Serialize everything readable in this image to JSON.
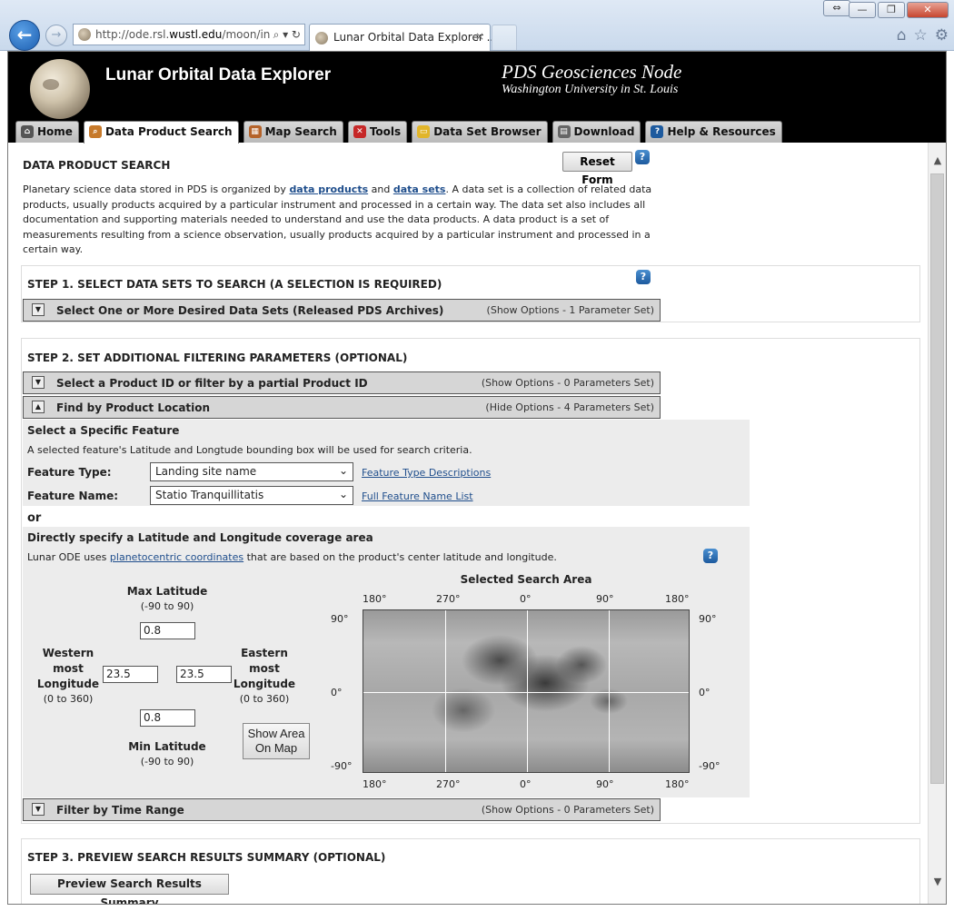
{
  "browser": {
    "url_prefix": "http://ode.rsl.",
    "url_domain": "wustl.edu",
    "url_suffix": "/moon/in",
    "tab_title": "Lunar Orbital Data Explorer ...",
    "tab_close": "×",
    "back": "←",
    "forward": "→",
    "addr_icons": "⌕ ▾ ↻",
    "win_buttons": [
      "—",
      "❐",
      "✕"
    ],
    "resize": "⇔",
    "tools": [
      "⌂",
      "☆",
      "⚙"
    ]
  },
  "header": {
    "title": "Lunar Orbital Data Explorer",
    "node_title": "PDS Geosciences Node",
    "node_sub": "Washington University in St. Louis"
  },
  "nav": {
    "tabs": [
      {
        "label": "Home",
        "icon": "home-icon",
        "color": "#555555"
      },
      {
        "label": "Data Product Search",
        "icon": "search-icon",
        "color": "#c77a2b"
      },
      {
        "label": "Map Search",
        "icon": "map-icon",
        "color": "#b5632a"
      },
      {
        "label": "Tools",
        "icon": "tools-icon",
        "color": "#c62828"
      },
      {
        "label": "Data Set Browser",
        "icon": "folder-icon",
        "color": "#e1b52a"
      },
      {
        "label": "Download",
        "icon": "download-icon",
        "color": "#666666"
      },
      {
        "label": "Help & Resources",
        "icon": "help-icon",
        "color": "#1d5a9e"
      }
    ]
  },
  "page": {
    "title": "DATA PRODUCT SEARCH",
    "reset": "Reset Form",
    "help": "?",
    "intro": {
      "p1": "Planetary science data stored in PDS is organized by ",
      "link1": "data products",
      "p2": " and ",
      "link2": "data sets",
      "p3": ". A data set is a collection of related data products, usually products acquired by a particular instrument and processed in a certain way. The data set also includes all documentation and supporting materials needed to understand and use the data products. A data product is a set of measurements resulting from a science observation, usually products acquired by a particular instrument and processed in a certain way."
    }
  },
  "step1": {
    "title": "STEP 1. SELECT DATA SETS TO SEARCH (A SELECTION IS REQUIRED)",
    "bar_label": "Select One or More Desired Data Sets (Released PDS Archives)",
    "bar_status": "(Show Options - 1 Parameter Set)"
  },
  "step2": {
    "title": "STEP 2. SET ADDITIONAL FILTERING PARAMETERS (OPTIONAL)",
    "product_bar": {
      "label": "Select a Product ID or filter by a partial Product ID",
      "status": "(Show Options - 0 Parameters Set)"
    },
    "location_bar": {
      "label": "Find by Product Location",
      "status": "(Hide Options - 4 Parameters Set)"
    },
    "feature": {
      "heading": "Select a Specific Feature",
      "desc": "A selected feature's Latitude and Longtude bounding box will be used for search criteria.",
      "type_label": "Feature Type:",
      "type_value": "Landing site name",
      "type_link": "Feature Type Descriptions",
      "name_label": "Feature Name:",
      "name_value": "Statio Tranquillitatis",
      "name_link": "Full Feature Name List"
    },
    "or": "or",
    "coords": {
      "heading": "Directly specify a Latitude and Longitude coverage area",
      "desc_pre": "Lunar ODE uses ",
      "desc_link": "planetocentric coordinates",
      "desc_post": " that are based on the product's center latitude and longitude.",
      "max_lat_label": "Max Latitude",
      "max_lat_range": "(-90 to 90)",
      "max_lat_value": "0.8",
      "min_lat_label": "Min Latitude",
      "min_lat_range": "(-90 to 90)",
      "min_lat_value": "0.8",
      "west_label_1": "Western",
      "west_label_2": "most",
      "west_label_3": "Longitude",
      "west_range": "(0 to 360)",
      "west_value": "23.5",
      "east_label_1": "Eastern",
      "east_label_2": "most",
      "east_label_3": "Longitude",
      "east_range": "(0 to 360)",
      "east_value": "23.5",
      "show_btn_1": "Show Area",
      "show_btn_2": "On Map"
    },
    "map": {
      "title": "Selected Search Area",
      "lon_ticks": [
        "180°",
        "270°",
        "0°",
        "90°",
        "180°"
      ],
      "lat_ticks": [
        "90°",
        "0°",
        "-90°"
      ]
    },
    "time_bar": {
      "label": "Filter by Time Range",
      "status": "(Show Options - 0 Parameters Set)"
    }
  },
  "step3": {
    "title": "STEP 3. PREVIEW SEARCH RESULTS SUMMARY (OPTIONAL)",
    "button": "Preview Search Results Summary"
  },
  "scroll": {
    "up": "▲",
    "down": "▼"
  }
}
